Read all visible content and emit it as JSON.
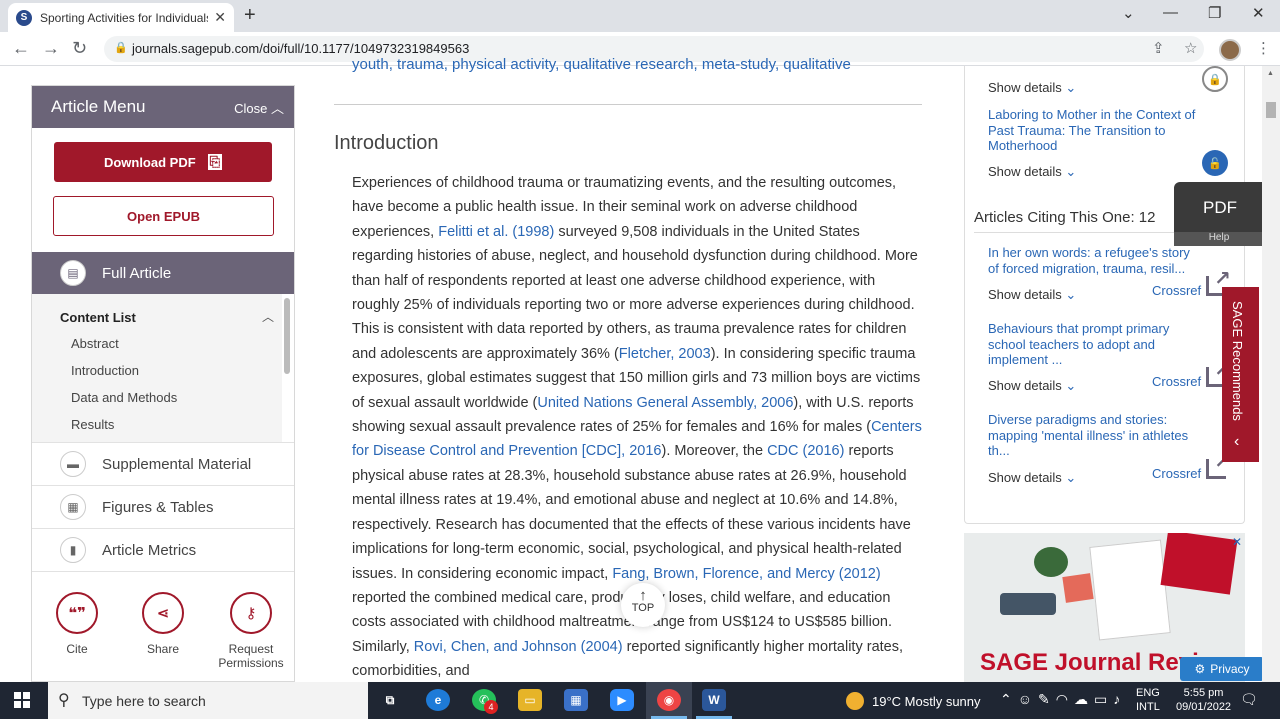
{
  "browser": {
    "tab_title": "Sporting Activities for Individuals",
    "tab_favicon": "S",
    "url": "journals.sagepub.com/doi/full/10.1177/1049732319849563"
  },
  "menu": {
    "title": "Article Menu",
    "close_label": "Close",
    "download_pdf": "Download PDF",
    "open_epub": "Open EPUB",
    "full_article": "Full Article",
    "content_list_title": "Content List",
    "content_items": [
      "Abstract",
      "Introduction",
      "Data and Methods",
      "Results"
    ],
    "sections": [
      "Supplemental Material",
      "Figures & Tables",
      "Article Metrics"
    ],
    "actions": {
      "cite": "Cite",
      "share": "Share",
      "request_1": "Request",
      "request_2": "Permissions"
    }
  },
  "article": {
    "keywords": "youth, trauma, physical activity, qualitative research, meta-study, qualitative",
    "heading": "Introduction",
    "p": [
      "Experiences of childhood trauma or traumatizing events, and the resulting outcomes, have become a public health issue. In their seminal work on adverse childhood experiences, ",
      "Felitti et al. (1998)",
      " surveyed 9,508 individuals in the United States regarding histories of abuse, neglect, and household dysfunction during childhood. More than half of respondents reported at least one adverse childhood experience, with roughly 25% of individuals reporting two or more adverse experiences during childhood. This is consistent with data reported by others, as trauma prevalence rates for children and adolescents are approximately 36% (",
      "Fletcher, 2003",
      "). In considering specific trauma exposures, global estimates suggest that 150 million girls and 73 million boys are victims of sexual assault worldwide (",
      "United Nations General Assembly, 2006",
      "), with U.S. reports showing sexual assault prevalence rates of 25% for females and 16% for males (",
      "Centers for Disease Control and Prevention [CDC], 2016",
      "). Moreover, the ",
      "CDC (2016)",
      " reports physical abuse rates at 28.3%, household substance abuse rates at 26.9%, household mental illness rates at 19.4%, and emotional abuse and neglect at 10.6% and 14.8%, respectively. Research has documented that the effects of these various incidents have implications for long-term economic, social, psychological, and physical health-related issues. In considering economic impact, ",
      "Fang, Brown, Florence, and Mercy (2012)",
      " reported the combined medical care, productivity loses, child welfare, and education costs associated with childhood maltreatment range from US$124 to US$585 billion. Similarly, ",
      "Rovi, Chen, and Johnson (2004)",
      " reported significantly higher mortality rates, comorbidities, and"
    ],
    "top_label": "TOP"
  },
  "sidebar": {
    "show_details": "Show details",
    "related_link": "Laboring to Mother in the Context of Past Trauma: The Transition to Motherhood",
    "citing_title": "Articles Citing This One: 12",
    "citing": [
      {
        "title": "In her own words: a refugee's story of forced migration, trauma, resil...",
        "source": "Crossref"
      },
      {
        "title": "Behaviours that prompt primary school teachers to adopt and implement ...",
        "source": "Crossref"
      },
      {
        "title": "Diverse paradigms and stories: mapping 'mental illness' in athletes th...",
        "source": "Crossref"
      }
    ],
    "pdf_widget": "PDF",
    "help": "Help",
    "sage_recommends": "SAGE Recommends",
    "ad_text": "SAGE Journal Reviewer Gatew",
    "privacy": "Privacy"
  },
  "taskbar": {
    "search_placeholder": "Type here to search",
    "weather": "19°C  Mostly sunny",
    "lang1": "ENG",
    "lang2": "INTL",
    "time": "5:55 pm",
    "date": "09/01/2022",
    "whatsapp_badge": "4"
  },
  "colors": {
    "sage_red": "#a0182a",
    "menu_purple": "#6b6478",
    "link_blue": "#2a67b5"
  }
}
